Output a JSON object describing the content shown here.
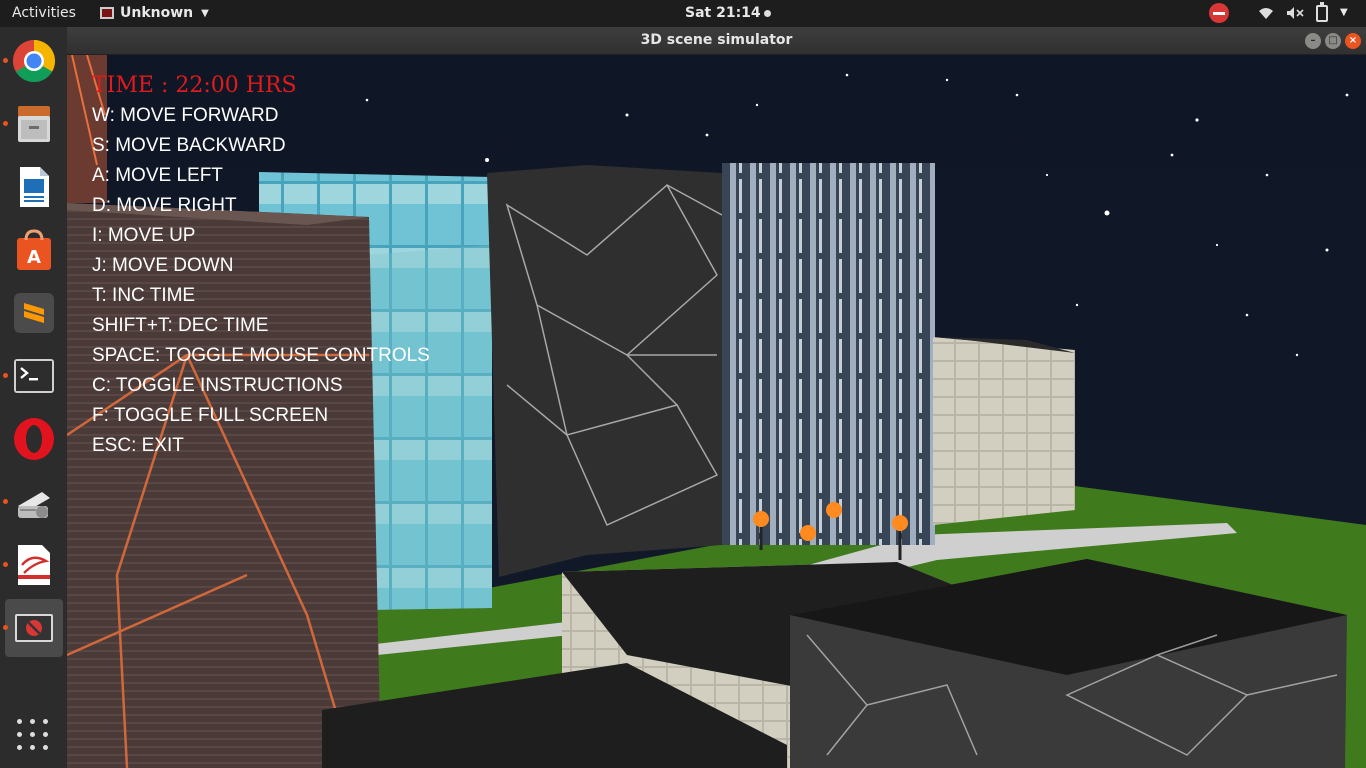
{
  "topbar": {
    "activities": "Activities",
    "app_name": "Unknown",
    "clock": "Sat 21:14"
  },
  "window": {
    "title": "3D scene simulator"
  },
  "dock": {
    "items": [
      {
        "name": "chrome-icon",
        "running": true
      },
      {
        "name": "files-icon",
        "running": true
      },
      {
        "name": "libreoffice-impress-icon",
        "running": false
      },
      {
        "name": "ubuntu-software-icon",
        "running": false
      },
      {
        "name": "sublime-text-icon",
        "running": false
      },
      {
        "name": "terminal-icon",
        "running": true
      },
      {
        "name": "opera-icon",
        "running": false
      },
      {
        "name": "scanner-icon",
        "running": true
      },
      {
        "name": "pdf-viewer-icon",
        "running": true
      },
      {
        "name": "unknown-app-icon",
        "running": true,
        "active": true
      }
    ]
  },
  "hud": {
    "time": "TIME : 22:00 HRS",
    "instructions": [
      "W: MOVE FORWARD",
      "S: MOVE BACKWARD",
      "A: MOVE LEFT",
      "D: MOVE RIGHT",
      "I: MOVE UP",
      "J: MOVE DOWN",
      "T: INC TIME",
      "SHIFT+T: DEC TIME",
      "SPACE: TOGGLE MOUSE CONTROLS",
      "C: TOGGLE INSTRUCTIONS",
      "F: TOGGLE FULL SCREEN",
      "ESC: EXIT"
    ]
  },
  "colors": {
    "hud_time": "#e01b1b",
    "ubuntu_accent": "#e95420",
    "sky": "#0e1420",
    "grass": "#3f7a1c"
  }
}
